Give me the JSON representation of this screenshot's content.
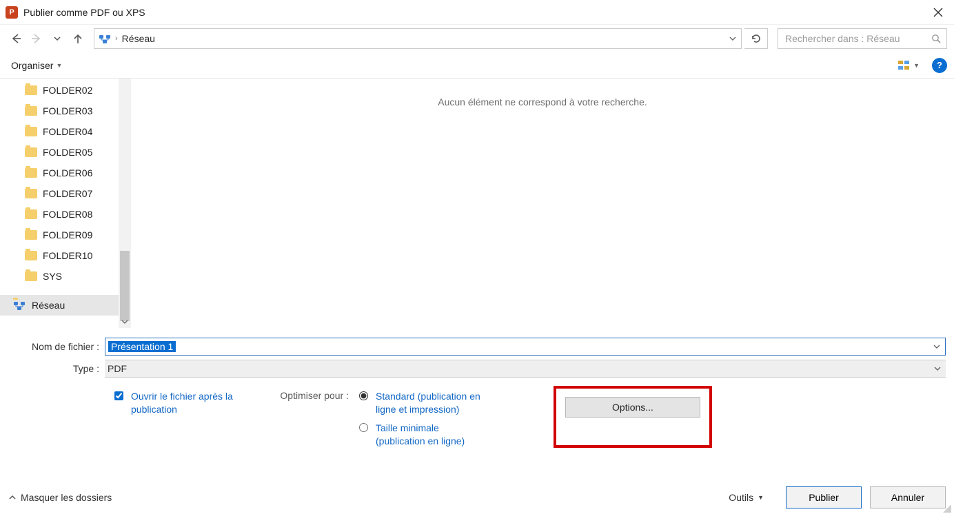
{
  "titlebar": {
    "title": "Publier comme PDF ou XPS"
  },
  "address": {
    "crumb": "Réseau"
  },
  "search": {
    "placeholder": "Rechercher dans : Réseau"
  },
  "toolbar": {
    "organiser_label": "Organiser"
  },
  "tree": {
    "folders": [
      {
        "label": "FOLDER02"
      },
      {
        "label": "FOLDER03"
      },
      {
        "label": "FOLDER04"
      },
      {
        "label": "FOLDER05"
      },
      {
        "label": "FOLDER06"
      },
      {
        "label": "FOLDER07"
      },
      {
        "label": "FOLDER08"
      },
      {
        "label": "FOLDER09"
      },
      {
        "label": "FOLDER10"
      },
      {
        "label": "SYS"
      }
    ],
    "network_label": "Réseau"
  },
  "content": {
    "empty_message": "Aucun élément ne correspond à votre recherche."
  },
  "form": {
    "filename_label": "Nom de fichier :",
    "filename_value": "Présentation 1",
    "type_label": "Type :",
    "type_value": "PDF",
    "open_after_label": "Ouvrir le fichier après la publication",
    "optimise_label": "Optimiser pour :",
    "radio_standard": "Standard (publication en ligne et impression)",
    "radio_minimal": "Taille minimale (publication en ligne)",
    "options_button": "Options..."
  },
  "footer": {
    "hide_folders": "Masquer les dossiers",
    "tools_label": "Outils",
    "publish_label": "Publier",
    "cancel_label": "Annuler"
  }
}
